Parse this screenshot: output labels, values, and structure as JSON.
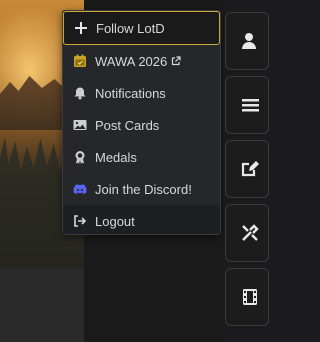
{
  "menu": {
    "items": [
      {
        "label": "Follow LotD",
        "icon": "plus-icon"
      },
      {
        "label": "WAWA 2026",
        "icon": "calendar-icon",
        "external": "external-link-icon"
      },
      {
        "label": "Notifications",
        "icon": "bell-icon"
      },
      {
        "label": "Post Cards",
        "icon": "image-icon"
      },
      {
        "label": "Medals",
        "icon": "medal-icon"
      },
      {
        "label": "Join the Discord!",
        "icon": "discord-icon"
      },
      {
        "label": "Logout",
        "icon": "logout-icon"
      }
    ]
  },
  "sidebar": {
    "buttons": [
      {
        "icon": "user-icon"
      },
      {
        "icon": "bars-icon"
      },
      {
        "icon": "edit-icon"
      },
      {
        "icon": "tools-icon"
      },
      {
        "icon": "film-icon"
      }
    ]
  },
  "colors": {
    "accent_border": "#c8a838",
    "discord": "#5865f2",
    "calendar": "#c9a227"
  }
}
